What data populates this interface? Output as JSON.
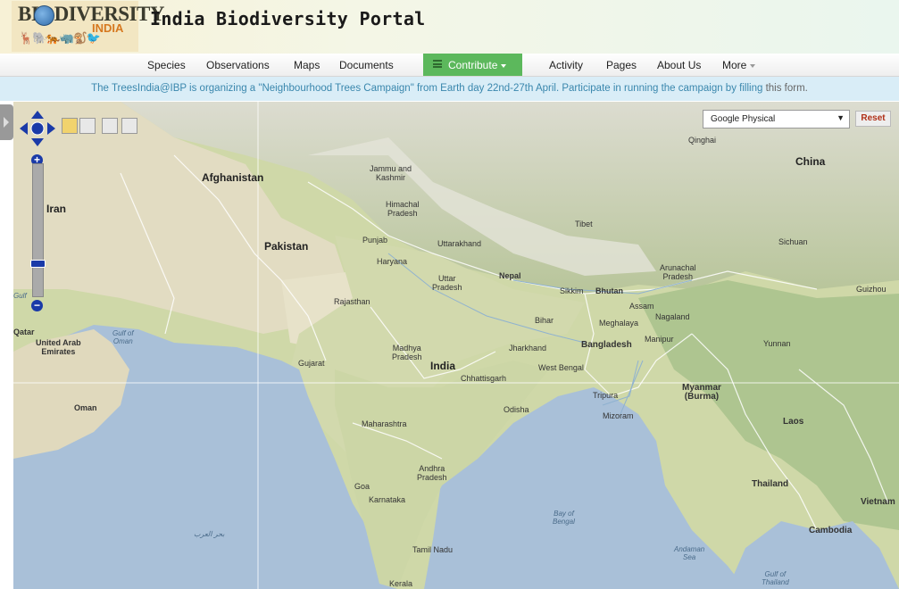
{
  "header": {
    "logo_top": "BIODIVERSITY",
    "logo_sub": "INDIA",
    "title": "India Biodiversity Portal"
  },
  "nav": {
    "items": [
      "Species",
      "Observations",
      "Maps",
      "Documents"
    ],
    "contribute": "Contribute",
    "items_right": [
      "Activity",
      "Pages",
      "About Us",
      "More"
    ]
  },
  "banner": {
    "text": "The TreesIndia@IBP is organizing a \"Neighbourhood Trees Campaign\" from Earth day 22nd-27th April. Participate in running the campaign by filling ",
    "link": "this form."
  },
  "map": {
    "layer_select": "Google Physical",
    "reset_label": "Reset",
    "countries": [
      "Afghanistan",
      "Iran",
      "Pakistan",
      "India",
      "China",
      "Nepal",
      "Bhutan",
      "Bangladesh",
      "Myanmar\n(Burma)",
      "Laos",
      "Thailand",
      "Cambodia",
      "Vietnam",
      "Oman",
      "United Arab\nEmirates",
      "Qatar"
    ],
    "states": [
      "Jammu and\nKashmir",
      "Himachal\nPradesh",
      "Punjab",
      "Uttarakhand",
      "Haryana",
      "Uttar\nPradesh",
      "Rajasthan",
      "Gujarat",
      "Madhya\nPradesh",
      "Bihar",
      "Jharkhand",
      "West Bengal",
      "Chhattisgarh",
      "Odisha",
      "Maharashtra",
      "Andhra\nPradesh",
      "Goa",
      "Karnataka",
      "Tamil Nadu",
      "Kerala",
      "Sikkim",
      "Assam",
      "Meghalaya",
      "Nagaland",
      "Manipur",
      "Tripura",
      "Mizoram",
      "Arunachal\nPradesh",
      "Tibet",
      "Qinghai",
      "Sichuan",
      "Guizhou",
      "Yunnan"
    ],
    "water": [
      "Gulf of\nOman",
      "Bay of\nBengal",
      "Andaman\nSea",
      "Gulf of\nThailand",
      "Gulf",
      "بحر العرب"
    ]
  }
}
